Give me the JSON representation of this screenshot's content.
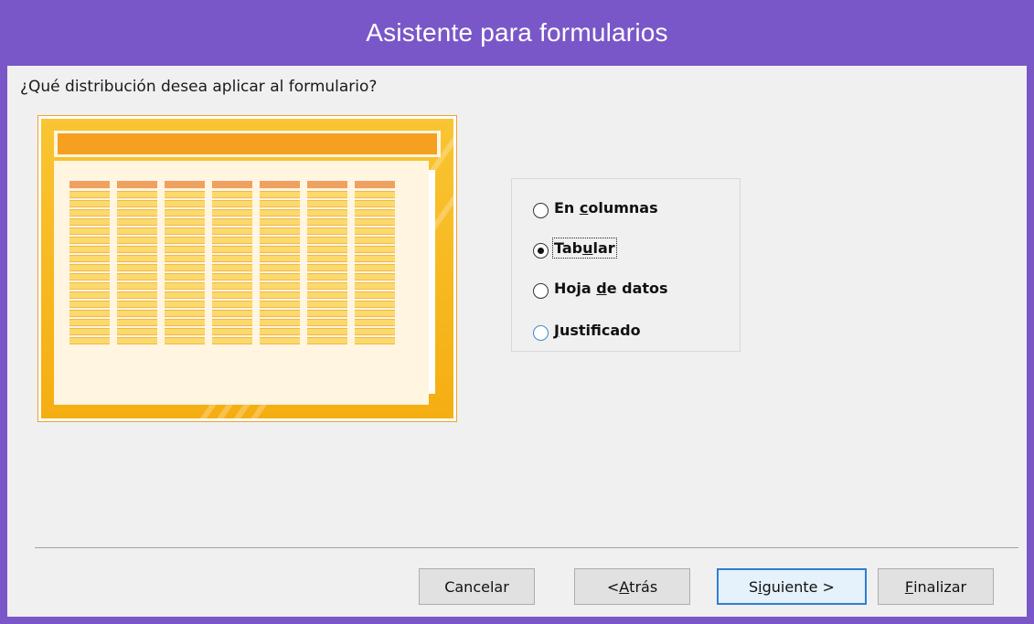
{
  "window": {
    "title": "Asistente para formularios",
    "titlebar_color": "#7a57c8",
    "client_bg": "#f0f0f0"
  },
  "question": "¿Qué distribución desea aplicar al formulario?",
  "preview": {
    "accent_color": "#f5a020",
    "frame_color": "#f9c532",
    "columns": 7,
    "rows": 17
  },
  "layout_options": [
    {
      "id": "columnar",
      "pre": "En ",
      "accel": "c",
      "post": "olumnas",
      "checked": false
    },
    {
      "id": "tabular",
      "pre": "Tab",
      "accel": "u",
      "post": "lar",
      "checked": true
    },
    {
      "id": "datasheet",
      "pre": "Hoja ",
      "accel": "d",
      "post": "e datos",
      "checked": false
    },
    {
      "id": "justified",
      "pre": "",
      "accel": "J",
      "post": "ustificado",
      "checked": false
    }
  ],
  "buttons": {
    "cancel": {
      "label": "Cancelar"
    },
    "back": {
      "pre": "< ",
      "accel": "A",
      "post": "trás"
    },
    "next": {
      "pre": "S",
      "accel": "i",
      "post": "guiente >"
    },
    "finish": {
      "pre": "",
      "accel": "F",
      "post": "inalizar"
    }
  }
}
